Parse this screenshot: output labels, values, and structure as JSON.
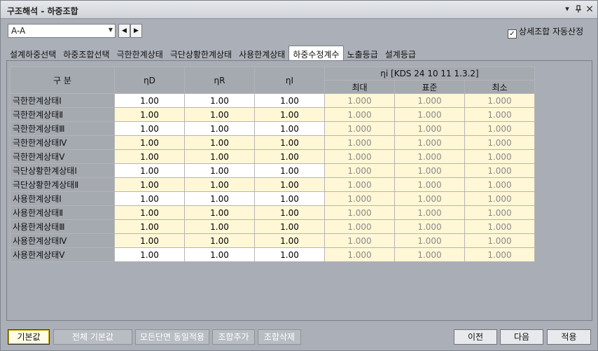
{
  "window": {
    "title": "구조해석 - 하중조합",
    "controls": {
      "dropdown": "▾",
      "pin": "ᵠ",
      "close": "×"
    }
  },
  "toolbar": {
    "section": "A-A",
    "prev": "◀",
    "next": "▶",
    "auto_calc_label": "상세조합 자동산정",
    "auto_calc_checked": true
  },
  "tabs": [
    {
      "label": "설계하중선택"
    },
    {
      "label": "하중조합선택"
    },
    {
      "label": "극한한계상태"
    },
    {
      "label": "극단상황한계상태"
    },
    {
      "label": "사용한계상태"
    },
    {
      "label": "하중수정계수",
      "active": true
    },
    {
      "label": "노출등급"
    },
    {
      "label": "설계등급"
    }
  ],
  "table": {
    "col_headers": {
      "category": "구 분",
      "etaD": "ηD",
      "etaR": "ηR",
      "etaI": "ηI",
      "eta_group": "ηi [KDS 24 10 11 1.3.2]",
      "max": "최대",
      "std": "표준",
      "min": "최소"
    },
    "rows": [
      {
        "name": "극한한계상태Ⅰ",
        "d": "1.00",
        "r": "1.00",
        "i": "1.00",
        "max": "1.000",
        "std": "1.000",
        "min": "1.000",
        "editable": true
      },
      {
        "name": "극한한계상태Ⅱ",
        "d": "1.00",
        "r": "1.00",
        "i": "1.00",
        "max": "1.000",
        "std": "1.000",
        "min": "1.000",
        "editable": false
      },
      {
        "name": "극한한계상태Ⅲ",
        "d": "1.00",
        "r": "1.00",
        "i": "1.00",
        "max": "1.000",
        "std": "1.000",
        "min": "1.000",
        "editable": true
      },
      {
        "name": "극한한계상태Ⅳ",
        "d": "1.00",
        "r": "1.00",
        "i": "1.00",
        "max": "1.000",
        "std": "1.000",
        "min": "1.000",
        "editable": false
      },
      {
        "name": "극한한계상태Ⅴ",
        "d": "1.00",
        "r": "1.00",
        "i": "1.00",
        "max": "1.000",
        "std": "1.000",
        "min": "1.000",
        "editable": false
      },
      {
        "name": "극단상황한계상태Ⅰ",
        "d": "1.00",
        "r": "1.00",
        "i": "1.00",
        "max": "1.000",
        "std": "1.000",
        "min": "1.000",
        "editable": true
      },
      {
        "name": "극단상황한계상태Ⅱ",
        "d": "1.00",
        "r": "1.00",
        "i": "1.00",
        "max": "1.000",
        "std": "1.000",
        "min": "1.000",
        "editable": false
      },
      {
        "name": "사용한계상태Ⅰ",
        "d": "1.00",
        "r": "1.00",
        "i": "1.00",
        "max": "1.000",
        "std": "1.000",
        "min": "1.000",
        "editable": true
      },
      {
        "name": "사용한계상태Ⅱ",
        "d": "1.00",
        "r": "1.00",
        "i": "1.00",
        "max": "1.000",
        "std": "1.000",
        "min": "1.000",
        "editable": false
      },
      {
        "name": "사용한계상태Ⅲ",
        "d": "1.00",
        "r": "1.00",
        "i": "1.00",
        "max": "1.000",
        "std": "1.000",
        "min": "1.000",
        "editable": false
      },
      {
        "name": "사용한계상태Ⅳ",
        "d": "1.00",
        "r": "1.00",
        "i": "1.00",
        "max": "1.000",
        "std": "1.000",
        "min": "1.000",
        "editable": false
      },
      {
        "name": "사용한계상태Ⅴ",
        "d": "1.00",
        "r": "1.00",
        "i": "1.00",
        "max": "1.000",
        "std": "1.000",
        "min": "1.000",
        "editable": true
      }
    ]
  },
  "footer": {
    "default": "기본값",
    "all_default": "전체 기본값",
    "apply_all_sections": "모든단면 동일적용",
    "add_combo": "조합추가",
    "delete_combo": "조합삭제",
    "prev": "이전",
    "next": "다음",
    "apply": "적용"
  }
}
